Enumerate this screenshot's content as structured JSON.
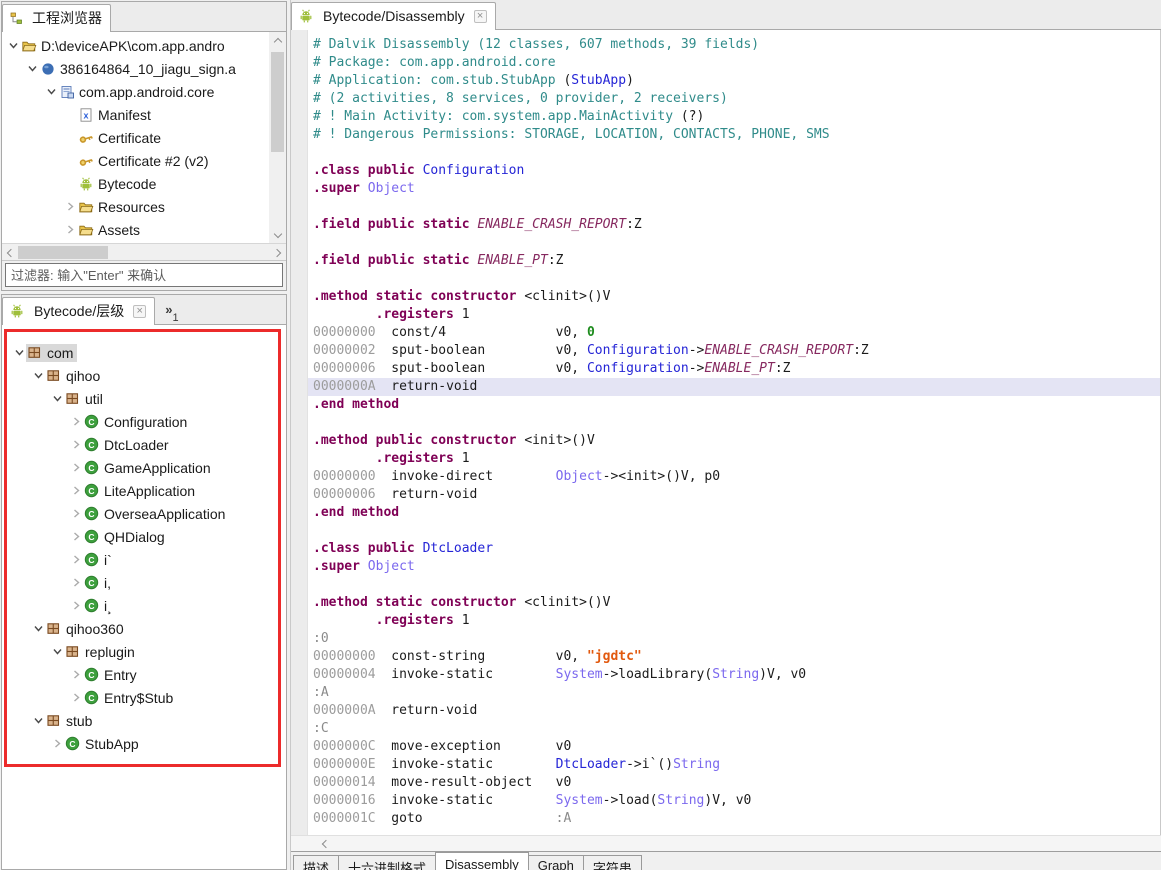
{
  "icons": {
    "close_glyph": "×",
    "overflow_chevron": "»"
  },
  "colors": {
    "comment": "#2F8B8A",
    "keyword": "#7F0055",
    "class_link": "#2525D6",
    "type": "#7B68EE",
    "field": "#86285F",
    "string": "#E2590E",
    "number": "#1E8C1E",
    "address": "#9C9C9C",
    "label": "#8A8A8A",
    "text": "#1B1B1B",
    "line_highlight": "#E4E4F4",
    "annotation_box": "#EC2B2B",
    "selection_bg": "#D9D9D9"
  },
  "left": {
    "project_panel": {
      "tab_label": "工程浏览器",
      "filter_placeholder": "过滤器: 输入\"Enter\" 来确认",
      "tree": [
        {
          "indent": 0,
          "arrow": "expanded",
          "icon": "folder-open-icon",
          "label": "D:\\deviceAPK\\com.app.andro"
        },
        {
          "indent": 1,
          "arrow": "expanded",
          "icon": "apk-file-icon",
          "label": "386164864_10_jiagu_sign.a"
        },
        {
          "indent": 2,
          "arrow": "expanded",
          "icon": "package-archive-icon",
          "label": "com.app.android.core"
        },
        {
          "indent": 3,
          "arrow": "none",
          "icon": "xml-file-icon",
          "label": "Manifest"
        },
        {
          "indent": 3,
          "arrow": "none",
          "icon": "certificate-key-icon",
          "label": "Certificate"
        },
        {
          "indent": 3,
          "arrow": "none",
          "icon": "certificate-key-icon",
          "label": "Certificate #2 (v2)"
        },
        {
          "indent": 3,
          "arrow": "none",
          "icon": "android-icon",
          "label": "Bytecode"
        },
        {
          "indent": 3,
          "arrow": "collapsed",
          "icon": "folder-icon",
          "label": "Resources"
        },
        {
          "indent": 3,
          "arrow": "collapsed",
          "icon": "folder-icon",
          "label": "Assets"
        }
      ]
    },
    "hierarchy_panel": {
      "tab_label": "Bytecode/层级",
      "overflow_count": "1",
      "tree": [
        {
          "indent": 0,
          "arrow": "expanded",
          "icon": "package-icon",
          "label": "com",
          "selected": true
        },
        {
          "indent": 1,
          "arrow": "expanded",
          "icon": "package-icon",
          "label": "qihoo"
        },
        {
          "indent": 2,
          "arrow": "expanded",
          "icon": "package-icon",
          "label": "util"
        },
        {
          "indent": 3,
          "arrow": "collapsed",
          "icon": "class-icon",
          "label": "Configuration"
        },
        {
          "indent": 3,
          "arrow": "collapsed",
          "icon": "class-icon",
          "label": "DtcLoader"
        },
        {
          "indent": 3,
          "arrow": "collapsed",
          "icon": "class-icon",
          "label": "GameApplication"
        },
        {
          "indent": 3,
          "arrow": "collapsed",
          "icon": "class-icon",
          "label": "LiteApplication"
        },
        {
          "indent": 3,
          "arrow": "collapsed",
          "icon": "class-icon",
          "label": "OverseaApplication"
        },
        {
          "indent": 3,
          "arrow": "collapsed",
          "icon": "class-icon",
          "label": "QHDialog"
        },
        {
          "indent": 3,
          "arrow": "collapsed",
          "icon": "class-icon",
          "label": "i`"
        },
        {
          "indent": 3,
          "arrow": "collapsed",
          "icon": "class-icon",
          "label": "i,"
        },
        {
          "indent": 3,
          "arrow": "collapsed",
          "icon": "class-icon",
          "label": "i¸"
        },
        {
          "indent": 1,
          "arrow": "expanded",
          "icon": "package-icon",
          "label": "qihoo360"
        },
        {
          "indent": 2,
          "arrow": "expanded",
          "icon": "package-icon",
          "label": "replugin"
        },
        {
          "indent": 3,
          "arrow": "collapsed",
          "icon": "class-icon",
          "label": "Entry"
        },
        {
          "indent": 3,
          "arrow": "collapsed",
          "icon": "class-icon",
          "label": "Entry$Stub"
        },
        {
          "indent": 1,
          "arrow": "expanded",
          "icon": "package-icon",
          "label": "stub"
        },
        {
          "indent": 2,
          "arrow": "collapsed",
          "icon": "class-icon",
          "label": "StubApp"
        }
      ]
    }
  },
  "main": {
    "tab_label": "Bytecode/Disassembly",
    "code_lines": [
      {
        "s": [
          [
            "# Dalvik Disassembly (12 classes, 607 methods, 39 fields)",
            "c"
          ]
        ]
      },
      {
        "s": [
          [
            "# Package: com.app.android.core",
            "c"
          ]
        ]
      },
      {
        "s": [
          [
            "# Application: com.stub.StubApp ",
            "c"
          ],
          [
            "(",
            "t"
          ],
          [
            "StubApp",
            "b"
          ],
          [
            ")",
            "t"
          ]
        ]
      },
      {
        "s": [
          [
            "# (2 activities, 8 services, 0 provider, 2 receivers)",
            "c"
          ]
        ]
      },
      {
        "s": [
          [
            "# ! Main Activity: com.system.app.MainActivity ",
            "c"
          ],
          [
            "(?)",
            "t"
          ]
        ]
      },
      {
        "s": [
          [
            "# ! Dangerous Permissions: STORAGE, LOCATION, CONTACTS, PHONE, SMS",
            "c"
          ]
        ]
      },
      {
        "s": []
      },
      {
        "s": [
          [
            ".class public ",
            "k"
          ],
          [
            "Configuration",
            "b"
          ]
        ]
      },
      {
        "s": [
          [
            ".super ",
            "k"
          ],
          [
            "Object",
            "p"
          ]
        ]
      },
      {
        "s": []
      },
      {
        "s": [
          [
            ".field public static ",
            "k"
          ],
          [
            "ENABLE_CRASH_REPORT",
            "f"
          ],
          [
            ":Z",
            "t"
          ]
        ]
      },
      {
        "s": []
      },
      {
        "s": [
          [
            ".field public static ",
            "k"
          ],
          [
            "ENABLE_PT",
            "f"
          ],
          [
            ":Z",
            "t"
          ]
        ]
      },
      {
        "s": []
      },
      {
        "s": [
          [
            ".method static constructor ",
            "k"
          ],
          [
            "<clinit>()V",
            "t"
          ]
        ]
      },
      {
        "s": [
          [
            "        .registers",
            "k"
          ],
          [
            " 1",
            "t"
          ]
        ]
      },
      {
        "s": [
          [
            "00000000  ",
            "a"
          ],
          [
            "const/4              ",
            "t"
          ],
          [
            "v0, ",
            "t"
          ],
          [
            "0",
            "n"
          ]
        ]
      },
      {
        "s": [
          [
            "00000002  ",
            "a"
          ],
          [
            "sput-boolean         ",
            "t"
          ],
          [
            "v0, ",
            "t"
          ],
          [
            "Configuration",
            "b"
          ],
          [
            "->",
            "t"
          ],
          [
            "ENABLE_CRASH_REPORT",
            "f"
          ],
          [
            ":Z",
            "t"
          ]
        ]
      },
      {
        "s": [
          [
            "00000006  ",
            "a"
          ],
          [
            "sput-boolean         ",
            "t"
          ],
          [
            "v0, ",
            "t"
          ],
          [
            "Configuration",
            "b"
          ],
          [
            "->",
            "t"
          ],
          [
            "ENABLE_PT",
            "f"
          ],
          [
            ":Z",
            "t"
          ]
        ]
      },
      {
        "s": [
          [
            "0000000A  ",
            "a"
          ],
          [
            "return-void",
            "t"
          ]
        ],
        "hl": true
      },
      {
        "s": [
          [
            ".end method",
            "k"
          ]
        ]
      },
      {
        "s": []
      },
      {
        "s": [
          [
            ".method public constructor ",
            "k"
          ],
          [
            "<init>()V",
            "t"
          ]
        ]
      },
      {
        "s": [
          [
            "        .registers",
            "k"
          ],
          [
            " 1",
            "t"
          ]
        ]
      },
      {
        "s": [
          [
            "00000000  ",
            "a"
          ],
          [
            "invoke-direct        ",
            "t"
          ],
          [
            "Object",
            "p"
          ],
          [
            "-><init>()V, p0",
            "t"
          ]
        ]
      },
      {
        "s": [
          [
            "00000006  ",
            "a"
          ],
          [
            "return-void",
            "t"
          ]
        ]
      },
      {
        "s": [
          [
            ".end method",
            "k"
          ]
        ]
      },
      {
        "s": []
      },
      {
        "s": [
          [
            ".class public ",
            "k"
          ],
          [
            "DtcLoader",
            "b"
          ]
        ]
      },
      {
        "s": [
          [
            ".super ",
            "k"
          ],
          [
            "Object",
            "p"
          ]
        ]
      },
      {
        "s": []
      },
      {
        "s": [
          [
            ".method static constructor ",
            "k"
          ],
          [
            "<clinit>()V",
            "t"
          ]
        ]
      },
      {
        "s": [
          [
            "        .registers",
            "k"
          ],
          [
            " 1",
            "t"
          ]
        ]
      },
      {
        "s": [
          [
            ":0",
            "l"
          ]
        ]
      },
      {
        "s": [
          [
            "00000000  ",
            "a"
          ],
          [
            "const-string         ",
            "t"
          ],
          [
            "v0, ",
            "t"
          ],
          [
            "\"jgdtc\"",
            "s"
          ]
        ]
      },
      {
        "s": [
          [
            "00000004  ",
            "a"
          ],
          [
            "invoke-static        ",
            "t"
          ],
          [
            "System",
            "p"
          ],
          [
            "->loadLibrary(",
            "t"
          ],
          [
            "String",
            "p"
          ],
          [
            ")V, v0",
            "t"
          ]
        ]
      },
      {
        "s": [
          [
            ":A",
            "l"
          ]
        ]
      },
      {
        "s": [
          [
            "0000000A  ",
            "a"
          ],
          [
            "return-void",
            "t"
          ]
        ]
      },
      {
        "s": [
          [
            ":C",
            "l"
          ]
        ]
      },
      {
        "s": [
          [
            "0000000C  ",
            "a"
          ],
          [
            "move-exception       ",
            "t"
          ],
          [
            "v0",
            "t"
          ]
        ]
      },
      {
        "s": [
          [
            "0000000E  ",
            "a"
          ],
          [
            "invoke-static        ",
            "t"
          ],
          [
            "DtcLoader",
            "b"
          ],
          [
            "->i`()",
            "t"
          ],
          [
            "String",
            "p"
          ]
        ]
      },
      {
        "s": [
          [
            "00000014  ",
            "a"
          ],
          [
            "move-result-object   ",
            "t"
          ],
          [
            "v0",
            "t"
          ]
        ]
      },
      {
        "s": [
          [
            "00000016  ",
            "a"
          ],
          [
            "invoke-static        ",
            "t"
          ],
          [
            "System",
            "p"
          ],
          [
            "->load(",
            "t"
          ],
          [
            "String",
            "p"
          ],
          [
            ")V, v0",
            "t"
          ]
        ]
      },
      {
        "s": [
          [
            "0000001C  ",
            "a"
          ],
          [
            "goto                 ",
            "t"
          ],
          [
            ":A",
            "l"
          ]
        ]
      }
    ],
    "bottom_tabs": [
      {
        "label": "描述"
      },
      {
        "label": "十六进制格式"
      },
      {
        "label": "Disassembly",
        "active": true
      },
      {
        "label": "Graph"
      },
      {
        "label": "字符串"
      }
    ]
  }
}
